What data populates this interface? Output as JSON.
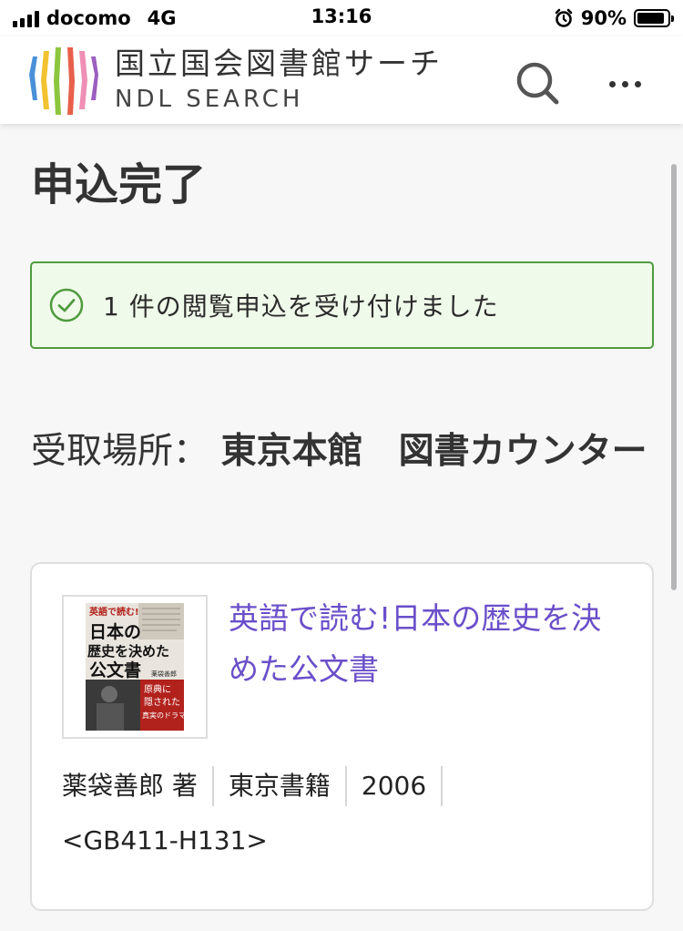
{
  "status_bar": {
    "carrier": "docomo",
    "network": "4G",
    "time": "13:16",
    "battery": "90%",
    "battery_level": 0.9
  },
  "header": {
    "logo_ja": "国立国会図書館サーチ",
    "logo_en": "NDL SEARCH",
    "logo_colors": [
      "#4a90d9",
      "#f2c230",
      "#8cc63f",
      "#e8604c",
      "#ef8fb3",
      "#9b5fc0"
    ],
    "search_icon": "search-icon",
    "more_icon": "more-icon"
  },
  "page": {
    "title": "申込完了",
    "alert_text": "1 件の閲覧申込を受け付けました",
    "alert_icon": "check-circle-icon",
    "alert_color": "#4f9a3f",
    "pickup_label": "受取場所：",
    "pickup_value": "東京本館　図書カウンター"
  },
  "item": {
    "title": "英語で読む!日本の歴史を決めた公文書",
    "author": "薬袋善郎 著",
    "publisher": "東京書籍",
    "year": "2006",
    "call_number": "<GB411-H131>",
    "cover": {
      "top_label": "英語で読む!",
      "main_title_lines": [
        "日本の",
        "歴史を決めた",
        "公文書"
      ],
      "author": "薬袋善郎",
      "subtitle_lines": [
        "原典に",
        "隠された",
        "真実のドラマ"
      ]
    },
    "link_color": "#6a4fc9"
  }
}
